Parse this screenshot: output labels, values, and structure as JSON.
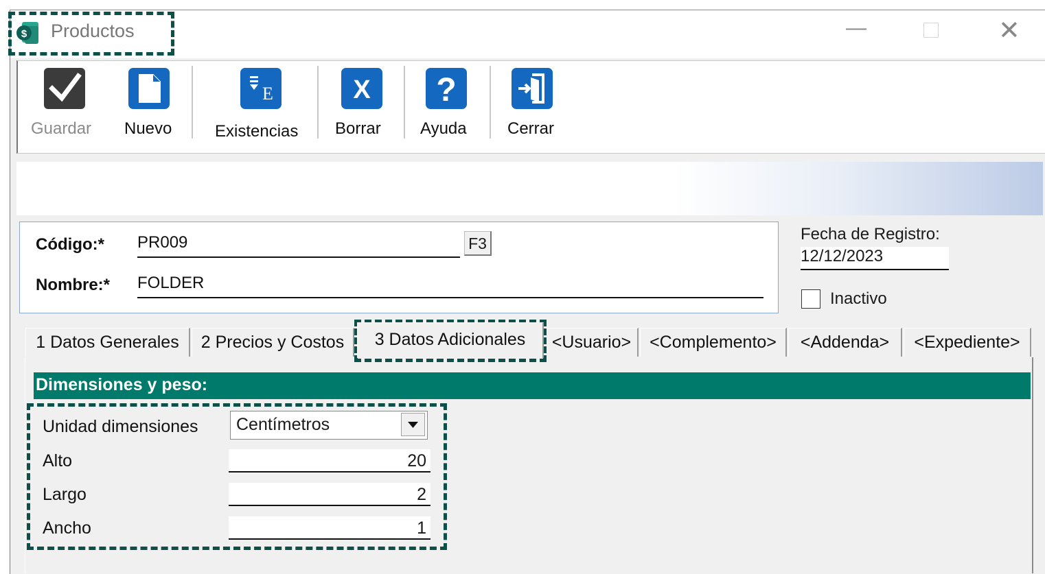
{
  "window": {
    "title": "Productos",
    "controls": [
      "minimize",
      "maximize",
      "close"
    ],
    "close_glyph": "✕",
    "minimize_glyph": "—"
  },
  "toolbar": {
    "items": [
      {
        "key": "guardar",
        "label": "Guardar",
        "mnemonic": "a",
        "enabled": false,
        "icon": "checkmark-icon"
      },
      {
        "key": "nuevo",
        "label": "Nuevo",
        "mnemonic": "N",
        "enabled": true,
        "icon": "new-document-icon"
      },
      {
        "key": "existencias",
        "label": "Existencias",
        "enabled": true,
        "icon": "inventory-icon"
      },
      {
        "key": "borrar",
        "label": "Borrar",
        "mnemonic": "B",
        "enabled": true,
        "icon": "delete-x-icon"
      },
      {
        "key": "ayuda",
        "label": "Ayuda",
        "enabled": true,
        "icon": "help-icon"
      },
      {
        "key": "cerrar",
        "label": "Cerrar",
        "mnemonic": "C",
        "enabled": true,
        "icon": "exit-door-icon"
      }
    ]
  },
  "header": {
    "codigo_label": "Código:*",
    "codigo_value": "PR009",
    "f3_label": "F3",
    "nombre_label": "Nombre:*",
    "nombre_value": "FOLDER",
    "fecha_label": "Fecha de Registro:",
    "fecha_value": "12/12/2023",
    "inactivo_label": "Inactivo",
    "inactivo_checked": false
  },
  "tabs": [
    {
      "label": "1 Datos Generales",
      "active": false
    },
    {
      "label": "2 Precios y Costos",
      "active": false
    },
    {
      "label": "3 Datos Adicionales",
      "active": true
    },
    {
      "label": "<Usuario>",
      "active": false
    },
    {
      "label": "<Complemento>",
      "active": false
    },
    {
      "label": "<Addenda>",
      "active": false
    },
    {
      "label": "<Expediente>",
      "active": false
    }
  ],
  "section": {
    "title": "Dimensiones y peso:",
    "unidad_label": "Unidad dimensiones",
    "unidad_value": "Centímetros",
    "fields": [
      {
        "label": "Alto",
        "value": "20"
      },
      {
        "label": "Largo",
        "value": "2"
      },
      {
        "label": "Ancho",
        "value": "1"
      }
    ]
  },
  "colors": {
    "section_header": "#007a6b",
    "toolbar_icon": "#1568c0",
    "annotation_dash": "#0d4f49",
    "panel_border": "#8aa6d4"
  }
}
